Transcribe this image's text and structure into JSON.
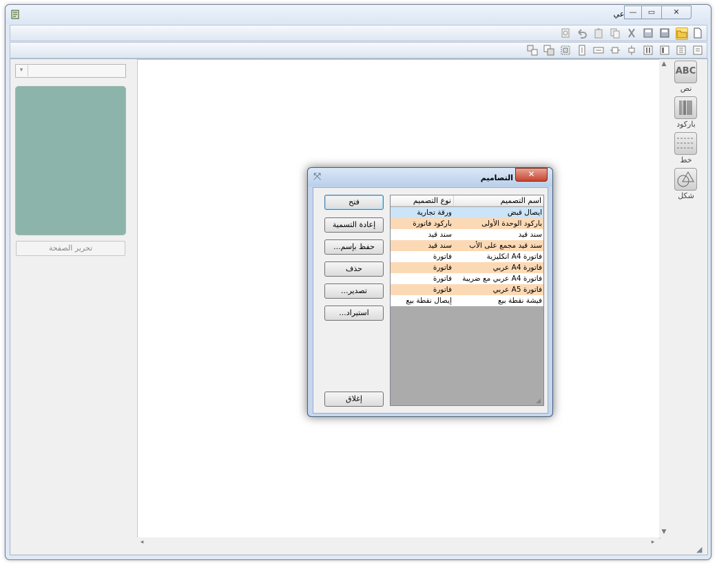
{
  "window": {
    "title": "المصمم الطباعي",
    "min_glyph": "—",
    "max_glyph": "▭",
    "close_glyph": "✕"
  },
  "toolbar1": {
    "icons": [
      "new-page-icon",
      "open-folder-icon",
      "save-icon",
      "save-as-icon",
      "cut-icon",
      "copy-icon",
      "paste-icon",
      "undo-icon",
      "print-preview-icon"
    ]
  },
  "toolbar2": {
    "icons": [
      "align-right-icon",
      "align-left-icon",
      "align-top-icon",
      "align-bottom-icon",
      "center-vertical-icon",
      "center-horizontal-icon",
      "space-horizontal-icon",
      "space-vertical-icon",
      "bring-front-icon",
      "send-back-icon"
    ]
  },
  "left_panel": {
    "combo_arrow": "▾",
    "edit_page_label": "تحرير الصفحة"
  },
  "toolbox": {
    "text": {
      "label": "نص",
      "icon_text": "ABC"
    },
    "barcode": {
      "label": "باركود"
    },
    "line": {
      "label": "خط"
    },
    "shape": {
      "label": "شكل"
    }
  },
  "scrollbars": {
    "up": "▲",
    "down": "▼",
    "left": "◂",
    "right": "▸"
  },
  "dialog": {
    "title": "التصاميم",
    "close_glyph": "✕",
    "pin_glyph": "⤧",
    "buttons": {
      "open": "فتح",
      "rename": "إعادة التسمية",
      "save_as": "حفظ بإسم...",
      "delete": "حذف",
      "export": "تصدير...",
      "import": "استيراد...",
      "close": "إغلاق"
    },
    "list": {
      "columns": [
        "اسم التصميم",
        "نوع التصميم"
      ],
      "rows": [
        {
          "name": "ايصال قبض",
          "type": "ورقة تجارية",
          "style": "selected"
        },
        {
          "name": "باركود الوحدة الأولى",
          "type": "باركود فاتورة",
          "style": "alt"
        },
        {
          "name": "سند قيد",
          "type": "سند قيد",
          "style": "normal"
        },
        {
          "name": "سند قيد مجمع على الأب",
          "type": "سند قيد",
          "style": "alt"
        },
        {
          "name": "فاتورة A4 انكليزية",
          "type": "فاتورة",
          "style": "normal"
        },
        {
          "name": "فاتورة A4 عربي",
          "type": "فاتورة",
          "style": "alt"
        },
        {
          "name": "فاتورة A4 عربي مع ضريبة",
          "type": "فاتورة",
          "style": "normal"
        },
        {
          "name": "فاتورة A5 عربي",
          "type": "فاتورة",
          "style": "alt"
        },
        {
          "name": "فيشة نقطة بيع",
          "type": "إيصال نقطة بيع",
          "style": "normal"
        }
      ]
    },
    "colors": {
      "selected": "#cce4f7",
      "alt": "#fcd9b5",
      "normal": "#ffffff"
    }
  }
}
